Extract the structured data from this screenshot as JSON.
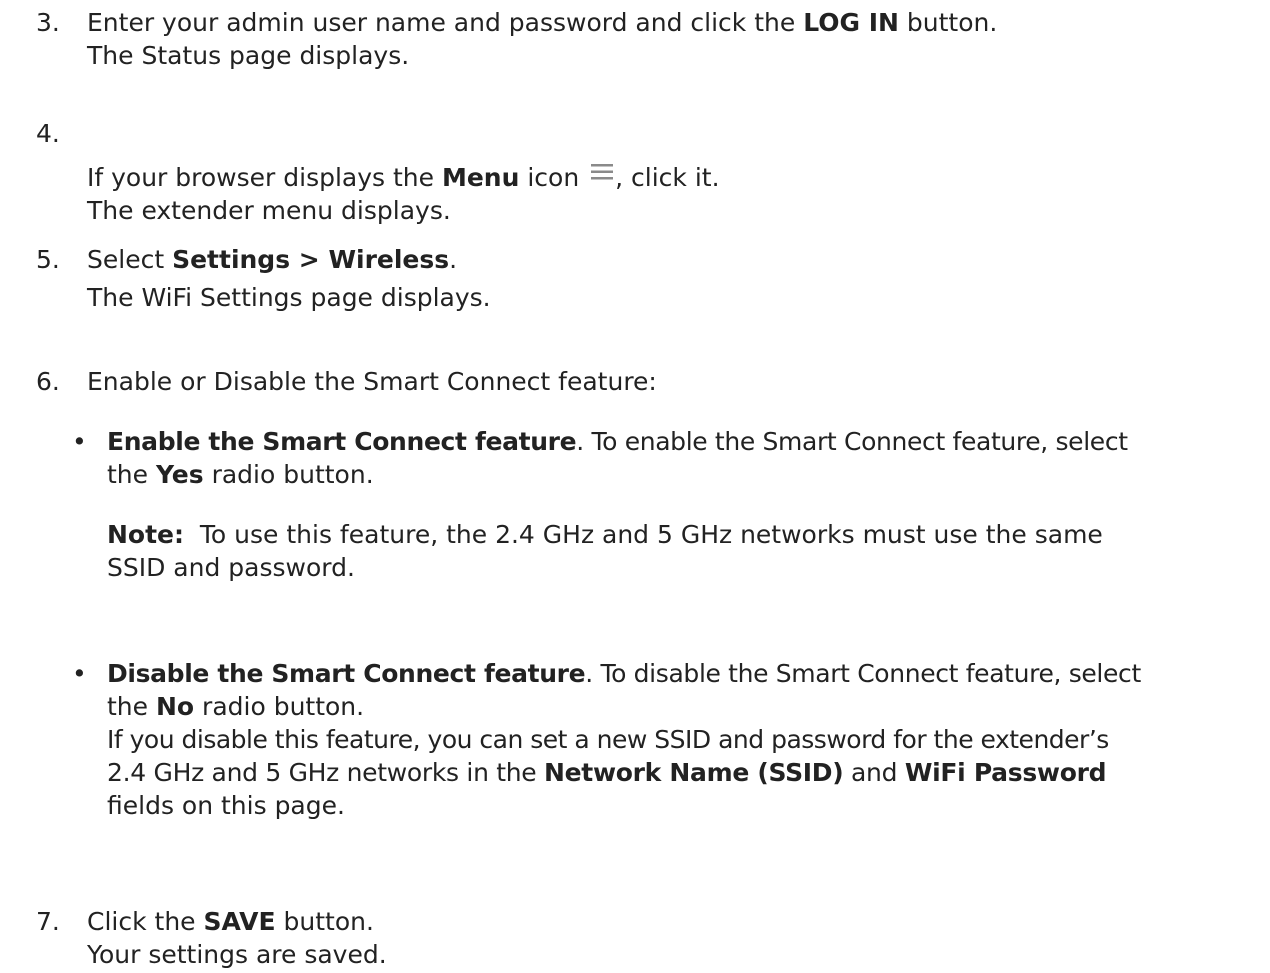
{
  "step3": {
    "num": "3.",
    "p1": "Enter your admin user name and password and click the ",
    "b1": "LOG IN",
    "p2": " button.",
    "result": "The Status page displays."
  },
  "step4": {
    "num": "4.",
    "p1": "If your browser displays the ",
    "b1": "Menu",
    "p2": " icon ",
    "p3": ", click it.",
    "result": "The extender menu displays."
  },
  "step5": {
    "num": "5.",
    "p1": "Select ",
    "b1": "Settings > Wireless",
    "p2": ".",
    "result": "The WiFi Settings page displays."
  },
  "step6": {
    "num": "6.",
    "text": "Enable or Disable the Smart Connect feature:",
    "bullet1": {
      "dot": "•",
      "b1": "Enable the Smart Connect feature",
      "p1": ". To enable the Smart Connect feature, select",
      "p2": "the ",
      "b2": "Yes",
      "p3": " radio button.",
      "note_label": "Note:",
      "note1": "  To use this feature, the 2.4 GHz and 5 GHz networks must use the same",
      "note2": "SSID and password."
    },
    "bullet2": {
      "dot": "•",
      "b1": "Disable the Smart Connect feature",
      "p1": ". To disable the Smart Connect feature, select",
      "p2": "the ",
      "b2": "No",
      "p3": " radio button.",
      "l3": "If you disable this feature, you can set a new SSID and password for the extender’s",
      "l4a": "2.4 GHz and 5 GHz networks in the ",
      "l4b": "Network Name (SSID)",
      "l4c": " and ",
      "l4d": "WiFi Password",
      "l5": "fields on this page."
    }
  },
  "step7": {
    "num": "7.",
    "p1": "Click the ",
    "b1": "SAVE",
    "p2": " button.",
    "result": "Your settings are saved."
  },
  "icons": {
    "menu": "hamburger-menu-icon",
    "menu_color": "#8a8a8a"
  }
}
